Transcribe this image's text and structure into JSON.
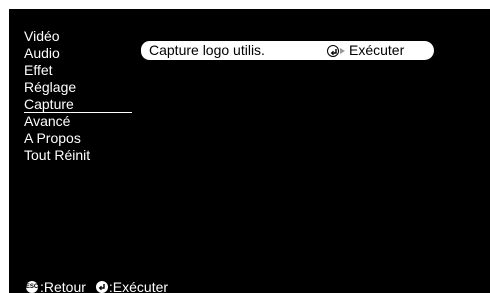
{
  "menu": {
    "items": [
      {
        "label": "Vidéo"
      },
      {
        "label": "Audio"
      },
      {
        "label": "Effet"
      },
      {
        "label": "Réglage"
      },
      {
        "label": "Capture",
        "selected": true
      },
      {
        "label": "Avancé"
      },
      {
        "label": "A Propos"
      },
      {
        "label": "Tout Réinit"
      }
    ]
  },
  "panel": {
    "option_label": "Capture logo utilis.",
    "action_label": "Exécuter",
    "action_icon": "enter-icon"
  },
  "footer": {
    "back_icon": "esc-icon",
    "back_label": ":Retour",
    "execute_icon": "enter-icon",
    "execute_label": ":Exécuter"
  },
  "colors": {
    "background": "#000000",
    "text": "#ffffff",
    "panel_bg": "#ffffff",
    "panel_text": "#000000"
  }
}
